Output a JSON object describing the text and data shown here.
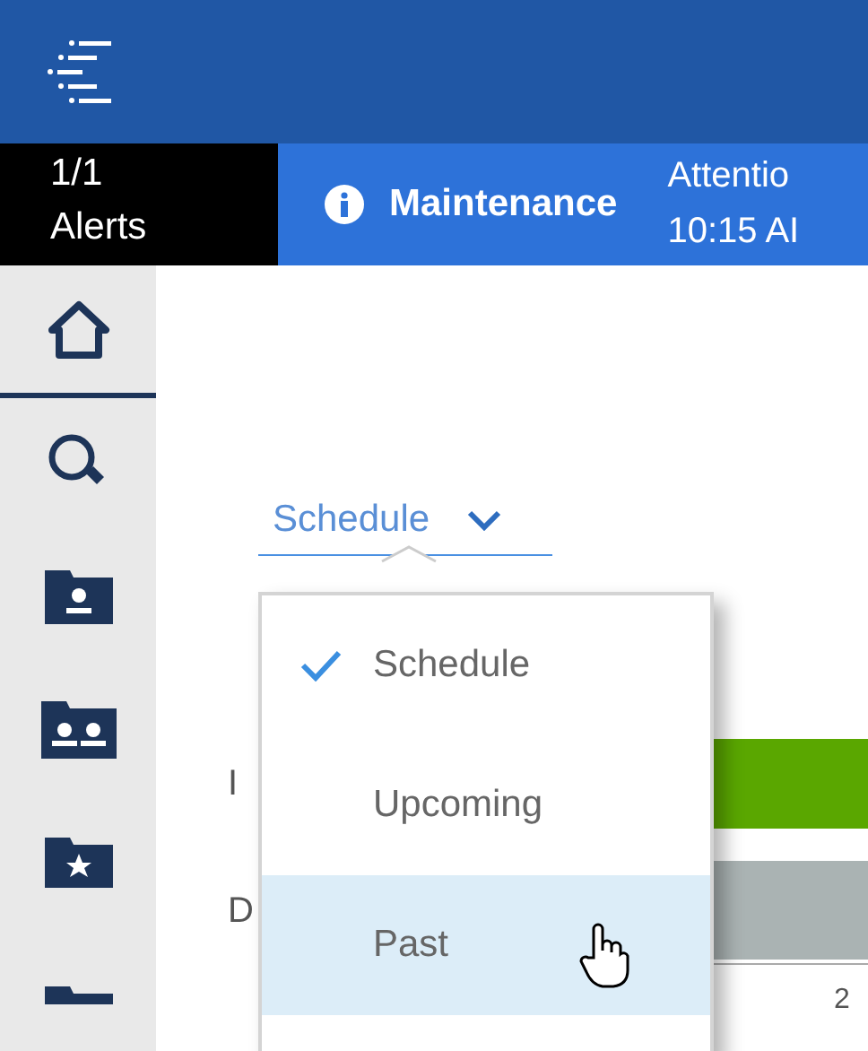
{
  "alert_bar": {
    "count": "1/1",
    "label": "Alerts",
    "category": "Maintenance",
    "message_line_1": "Attentio",
    "message_line_2": "10:15 AI"
  },
  "sidebar": {
    "items": [
      {
        "kind": "home",
        "selected": true
      },
      {
        "kind": "search",
        "selected": false
      },
      {
        "kind": "folder-person",
        "selected": false
      },
      {
        "kind": "folder-people",
        "selected": false
      },
      {
        "kind": "folder-star",
        "selected": false
      },
      {
        "kind": "folder",
        "selected": false
      }
    ]
  },
  "dropdown": {
    "value": "Schedule",
    "options": [
      {
        "label": "Schedule",
        "selected": true,
        "highlighted": false
      },
      {
        "label": "Upcoming",
        "selected": false,
        "highlighted": false
      },
      {
        "label": "Past",
        "selected": false,
        "highlighted": true
      }
    ]
  },
  "chart": {
    "rows": [
      {
        "label": "I",
        "color": "#5aa700"
      },
      {
        "label": "D",
        "color": "#aab3b3"
      }
    ],
    "tick": "2"
  }
}
